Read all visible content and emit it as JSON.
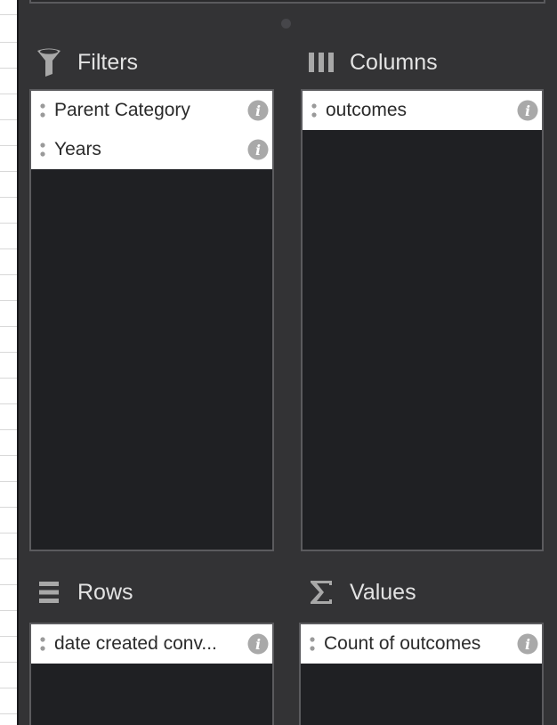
{
  "sections": {
    "filters": {
      "title": "Filters",
      "icon": "filter-icon",
      "items": [
        {
          "label": "Parent Category"
        },
        {
          "label": "Years"
        }
      ]
    },
    "columns": {
      "title": "Columns",
      "icon": "columns-icon",
      "items": [
        {
          "label": "outcomes"
        }
      ]
    },
    "rows": {
      "title": "Rows",
      "icon": "rows-icon",
      "items": [
        {
          "label": "date created conv..."
        }
      ]
    },
    "values": {
      "title": "Values",
      "icon": "sigma-icon",
      "items": [
        {
          "label": "Count of outcomes"
        }
      ]
    }
  },
  "colors": {
    "panel_background": "#333335",
    "drop_zone_background": "#1f2023",
    "item_background": "#ffffff",
    "header_text": "#e3e3e3",
    "icon_gray": "#a8a8a8"
  }
}
